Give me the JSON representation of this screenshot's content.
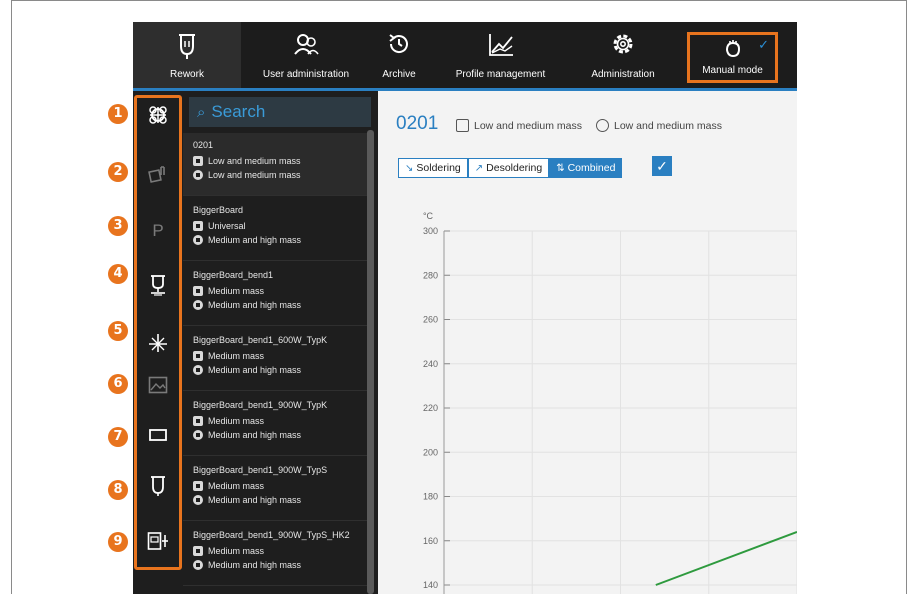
{
  "nav": {
    "items": [
      {
        "label": "Rework",
        "icon": "rework-tool-icon"
      },
      {
        "label": "User administration",
        "icon": "users-icon"
      },
      {
        "label": "Archive",
        "icon": "history-icon"
      },
      {
        "label": "Profile management",
        "icon": "chart-icon"
      },
      {
        "label": "Administration",
        "icon": "gear-icon"
      },
      {
        "label": "Manual mode",
        "icon": "hand-icon"
      }
    ],
    "active": "Rework",
    "highlighted": "Manual mode",
    "accent_color": "#e8741e"
  },
  "rail": {
    "icons": [
      "component-icon",
      "nozzle-icon",
      "profile-p-icon",
      "placement-icon",
      "light-icon",
      "image-icon",
      "rectangle-icon",
      "heater-icon",
      "settings-io-icon"
    ],
    "markers": [
      "1",
      "2",
      "3",
      "4",
      "5",
      "6",
      "7",
      "8",
      "9"
    ]
  },
  "search": {
    "placeholder": "Search"
  },
  "profiles": [
    {
      "name": "0201",
      "line1": "Low and medium mass",
      "line2": "Low and medium mass",
      "selected": true
    },
    {
      "name": "BiggerBoard",
      "line1": "Universal",
      "line2": "Medium and high mass"
    },
    {
      "name": "BiggerBoard_bend1",
      "line1": "Medium mass",
      "line2": "Medium and high mass"
    },
    {
      "name": "BiggerBoard_bend1_600W_TypK",
      "line1": "Medium mass",
      "line2": "Medium and high mass"
    },
    {
      "name": "BiggerBoard_bend1_900W_TypK",
      "line1": "Medium mass",
      "line2": "Medium and high mass"
    },
    {
      "name": "BiggerBoard_bend1_900W_TypS",
      "line1": "Medium mass",
      "line2": "Medium and high mass"
    },
    {
      "name": "BiggerBoard_bend1_900W_TypS_HK2",
      "line1": "Medium mass",
      "line2": "Medium and high mass"
    }
  ],
  "main": {
    "title": "0201",
    "meta1": "Low and medium mass",
    "meta2": "Low and medium mass",
    "modes": [
      "Soldering",
      "Desoldering",
      "Combined"
    ],
    "active_mode": "Combined",
    "check_icon": "checkbox-checked-icon"
  },
  "chart_data": {
    "type": "line",
    "ylabel": "°C",
    "ylim": [
      140,
      300
    ],
    "yticks": [
      300,
      280,
      260,
      240,
      220,
      200,
      180,
      160,
      140
    ],
    "grid": true,
    "series": [
      {
        "color": "#2e9a3e",
        "points": [
          [
            0.6,
            140
          ],
          [
            1.0,
            164
          ]
        ]
      }
    ],
    "xlim": [
      0,
      1
    ]
  }
}
